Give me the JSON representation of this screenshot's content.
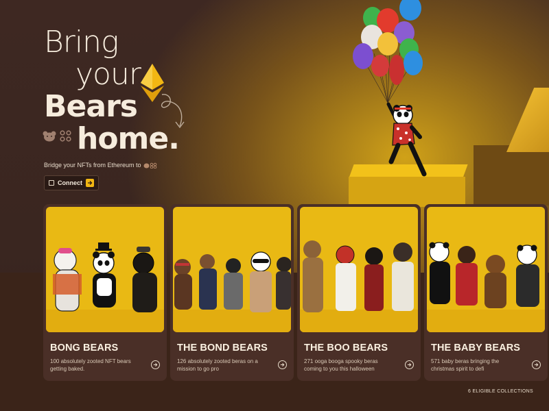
{
  "hero": {
    "line1": "Bring",
    "line2": "your",
    "line3": "Bears",
    "line4": "home.",
    "subtitle": "Bridge your NFTs from Ethereum to",
    "connect_label": "Connect"
  },
  "collections": [
    {
      "title": "BONG BEARS",
      "description": "100 absolutely zooted NFT bears getting baked."
    },
    {
      "title": "THE BOND BEARS",
      "description": "126 absolutely zooted beras on a mission to go pro"
    },
    {
      "title": "THE BOO BEARS",
      "description": "271 ooga booga spooky beras coming to you this halloween"
    },
    {
      "title": "THE BABY BEARS",
      "description": "571 baby beras bringing the christmas spirit to defi"
    }
  ],
  "footer": {
    "count_label": "6 ELIGIBLE COLLECTIONS"
  },
  "colors": {
    "accent": "#f2b713",
    "background": "#3a2620",
    "card": "#4a2f27",
    "card_art": "#e9b914"
  }
}
